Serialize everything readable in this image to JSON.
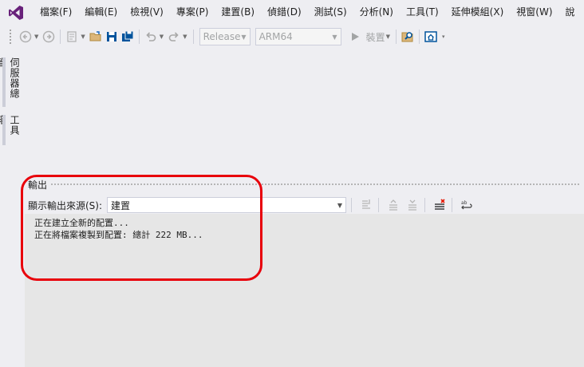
{
  "app": {
    "logo": "visual-studio-logo",
    "accent": "#68217a"
  },
  "menu": {
    "items": [
      "檔案(F)",
      "編輯(E)",
      "檢視(V)",
      "專案(P)",
      "建置(B)",
      "偵錯(D)",
      "測試(S)",
      "分析(N)",
      "工具(T)",
      "延伸模組(X)",
      "視窗(W)",
      "說"
    ]
  },
  "toolbar": {
    "configuration": "Release",
    "platform": "ARM64",
    "run_label": "裝置",
    "icons": [
      "back-icon",
      "forward-icon",
      "new-project-icon",
      "open-folder-icon",
      "save-icon",
      "save-all-icon",
      "undo-icon",
      "redo-icon",
      "find-in-files-icon",
      "home-icon"
    ]
  },
  "side_tabs": {
    "server_explorer": "伺服器總管",
    "toolbox": "工具箱"
  },
  "output": {
    "title": "輸出",
    "source_label": "顯示輸出來源(S):",
    "source_value": "建置",
    "lines": [
      "正在建立全新的配置...",
      "正在將檔案複製到配置: 總計 222 MB..."
    ]
  },
  "annotation": {
    "color": "#e8000b"
  }
}
